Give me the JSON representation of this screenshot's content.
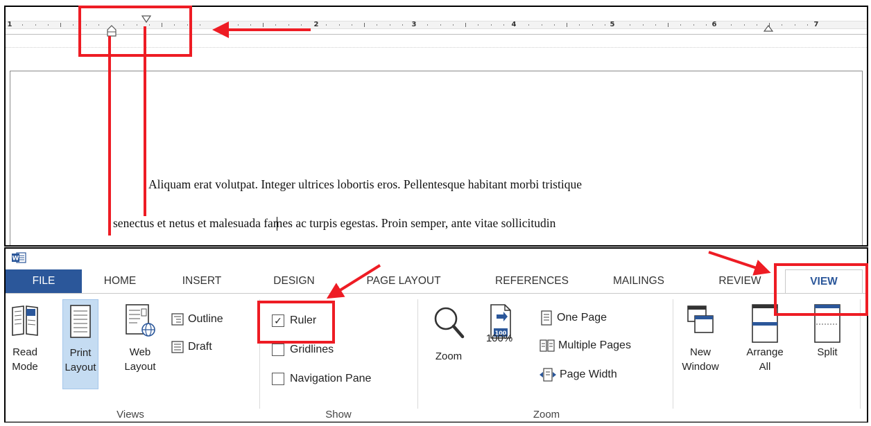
{
  "ruler": {
    "numbers": [
      "1",
      "2",
      "3",
      "4",
      "5",
      "6",
      "7"
    ]
  },
  "document": {
    "line1": "Aliquam erat volutpat. Integer ultrices lobortis eros. Pellentesque habitant morbi tristique",
    "line2": "senectus et netus et malesuada fames ac turpis egestas. Proin semper, ante vitae sollicitudin"
  },
  "ribbon": {
    "app_icon_label": "W",
    "tabs": [
      {
        "label": "FILE"
      },
      {
        "label": "HOME"
      },
      {
        "label": "INSERT"
      },
      {
        "label": "DESIGN"
      },
      {
        "label": "PAGE LAYOUT"
      },
      {
        "label": "REFERENCES"
      },
      {
        "label": "MAILINGS"
      },
      {
        "label": "REVIEW"
      },
      {
        "label": "VIEW"
      }
    ],
    "active_tab": "VIEW",
    "groups": {
      "views": {
        "label": "Views",
        "read_mode": {
          "line1": "Read",
          "line2": "Mode"
        },
        "print_layout": {
          "line1": "Print",
          "line2": "Layout"
        },
        "web_layout": {
          "line1": "Web",
          "line2": "Layout"
        },
        "outline": "Outline",
        "draft": "Draft"
      },
      "show": {
        "label": "Show",
        "ruler": {
          "label": "Ruler",
          "checked": true
        },
        "gridlines": {
          "label": "Gridlines",
          "checked": false
        },
        "navigation_pane": {
          "label": "Navigation Pane",
          "checked": false
        }
      },
      "zoom": {
        "label": "Zoom",
        "zoom_button": "Zoom",
        "hundred_button": "100%",
        "hundred_icon_text": "100",
        "one_page": "One Page",
        "multiple_pages": "Multiple Pages",
        "page_width": "Page Width"
      },
      "window": {
        "new_window": {
          "line1": "New",
          "line2": "Window"
        },
        "arrange_all": {
          "line1": "Arrange",
          "line2": "All"
        },
        "split": "Split"
      }
    }
  },
  "colors": {
    "annotation": "#ee1c24",
    "file_tab": "#2b579a",
    "selected_button": "#c5dcf2"
  }
}
